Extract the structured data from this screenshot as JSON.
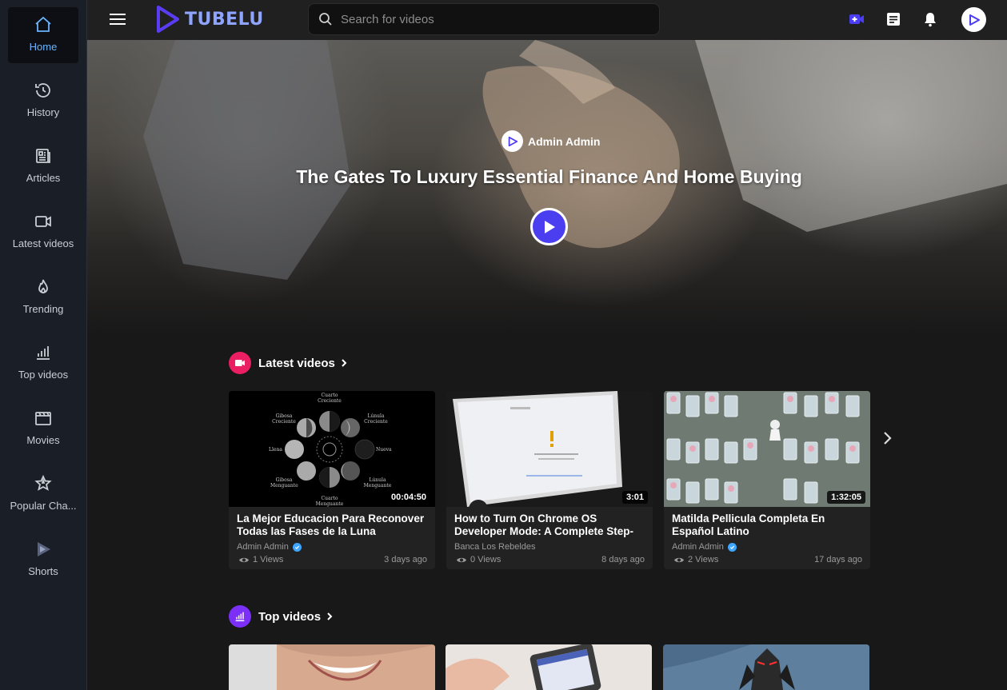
{
  "app": {
    "name": "TUBELU"
  },
  "sidebar": {
    "items": [
      {
        "label": "Home",
        "icon": "home-icon",
        "active": true
      },
      {
        "label": "History",
        "icon": "history-icon"
      },
      {
        "label": "Articles",
        "icon": "articles-icon"
      },
      {
        "label": "Latest videos",
        "icon": "video-camera-icon"
      },
      {
        "label": "Trending",
        "icon": "flame-icon"
      },
      {
        "label": "Top videos",
        "icon": "bar-chart-icon"
      },
      {
        "label": "Movies",
        "icon": "clapperboard-icon"
      },
      {
        "label": "Popular Cha...",
        "icon": "star-badge-icon"
      },
      {
        "label": "Shorts",
        "icon": "shorts-play-icon"
      }
    ]
  },
  "search": {
    "placeholder": "Search for videos"
  },
  "colors": {
    "accent": "#4b3df0",
    "sidebar_active_text": "#6cb4ff",
    "latest_badge": "#e91e63",
    "top_badge": "#7b2ff7",
    "verified": "#3ea6ff"
  },
  "hero": {
    "author": "Admin Admin",
    "title": "The Gates To Luxury Essential Finance And Home Buying"
  },
  "sections": {
    "latest": {
      "title": "Latest videos",
      "videos": [
        {
          "title": "La Mejor Educacion Para Reconover Todas las Fases de la Luna",
          "author": "Admin Admin",
          "verified": true,
          "views": "1 Views",
          "date": "3 days ago",
          "duration": "00:04:50"
        },
        {
          "title": "How to Turn On Chrome OS Developer Mode: A Complete Step-by-Step…",
          "author": "Banca Los Rebeldes",
          "verified": false,
          "views": "0 Views",
          "date": "8 days ago",
          "duration": "3:01"
        },
        {
          "title": "Matilda Pellicula Completa En Español Latino",
          "author": "Admin Admin",
          "verified": true,
          "views": "2 Views",
          "date": "17 days ago",
          "duration": "1:32:05"
        }
      ]
    },
    "top": {
      "title": "Top videos"
    }
  },
  "moon_labels": {
    "top": "Cuarto Creciente",
    "top_left": "Gibosa Creciente",
    "top_right": "Lúnula Creciente",
    "left": "Llena",
    "right": "Nueva",
    "bottom_left": "Gibosa Menguante",
    "bottom_right": "Lúnula Menguante",
    "bottom": "Cuarto Menguante"
  }
}
